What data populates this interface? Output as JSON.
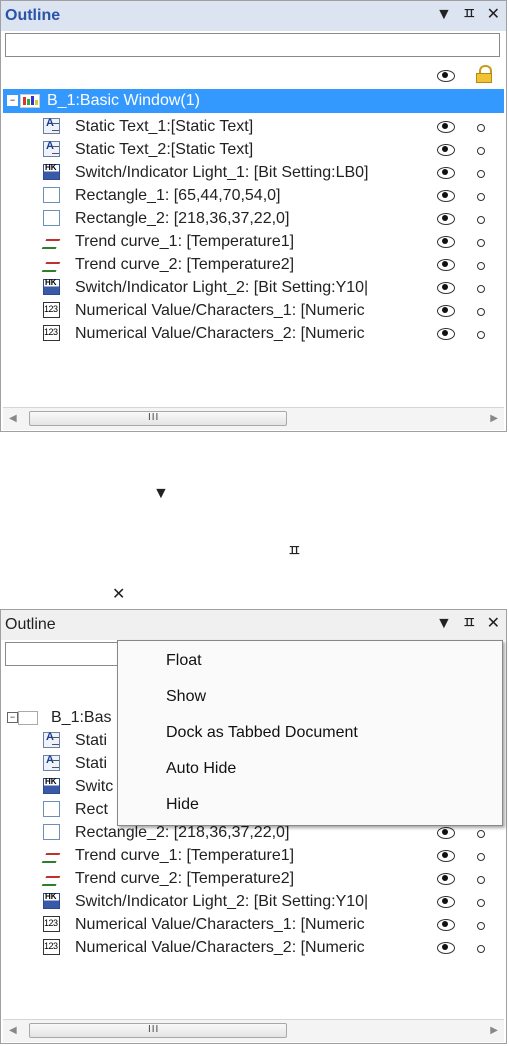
{
  "panel_title": "Outline",
  "titlebar_icons": [
    "dropdown-arrow-icon",
    "pin-icon",
    "close-icon"
  ],
  "root_label": "B_1:Basic Window(1)",
  "root_label_truncated": "B_1:Bas",
  "items": [
    {
      "label": "Static Text_1:[Static Text]",
      "icon": "static-text-icon"
    },
    {
      "label": "Static Text_2:[Static Text]",
      "icon": "static-text-icon"
    },
    {
      "label": "Switch/Indicator Light_1: [Bit Setting:LB0]",
      "icon": "switch-indicator-icon"
    },
    {
      "label": "Rectangle_1: [65,44,70,54,0]",
      "icon": "rectangle-icon"
    },
    {
      "label": "Rectangle_2: [218,36,37,22,0]",
      "icon": "rectangle-icon"
    },
    {
      "label": "Trend curve_1: [Temperature1]",
      "icon": "trend-curve-icon"
    },
    {
      "label": "Trend curve_2: [Temperature2]",
      "icon": "trend-curve-icon"
    },
    {
      "label": "Switch/Indicator Light_2: [Bit Setting:Y10|",
      "icon": "switch-indicator-icon"
    },
    {
      "label": "Numerical Value/Characters_1: [Numeric",
      "icon": "numeric-icon"
    },
    {
      "label": "Numerical Value/Characters_2: [Numeric",
      "icon": "numeric-icon"
    }
  ],
  "bottom_truncated": [
    "Stati",
    "Stati",
    "Switc",
    "Rect"
  ],
  "scroll_grip": "III",
  "context_menu": [
    "Float",
    "Show",
    "Dock as Tabbed Document",
    "Auto Hide",
    "Hide"
  ],
  "glyphs": {
    "dropdown": "▼",
    "pin": "ㅍ",
    "close": "✕"
  }
}
